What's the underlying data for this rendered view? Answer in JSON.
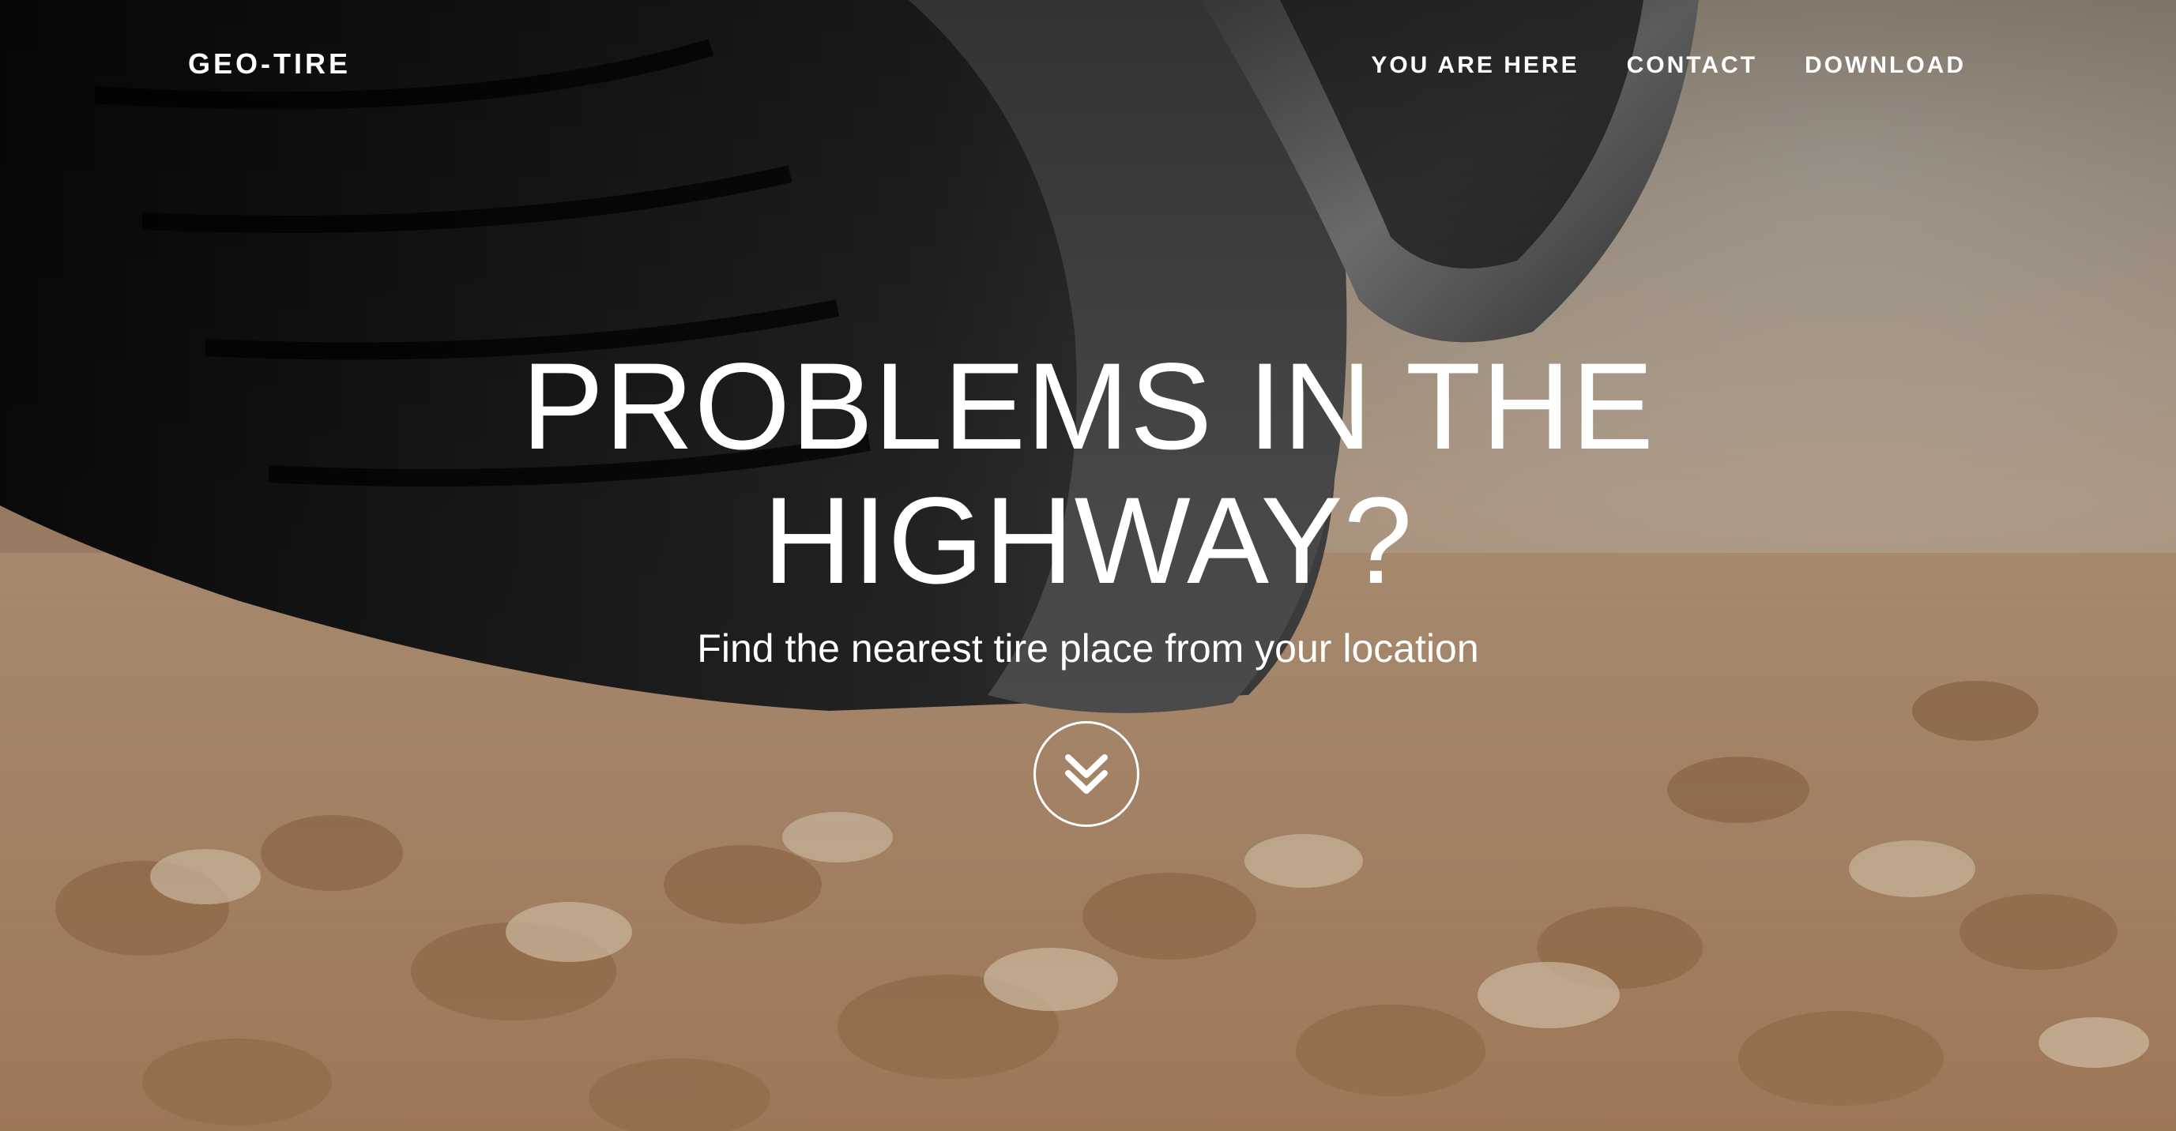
{
  "brand": {
    "name": "GEO-TIRE"
  },
  "nav": {
    "items": [
      {
        "label": "YOU ARE HERE"
      },
      {
        "label": "CONTACT"
      },
      {
        "label": "DOWNLOAD"
      }
    ]
  },
  "hero": {
    "headline_line1": "PROBLEMS IN THE",
    "headline_line2": "HIGHWAY?",
    "subtitle": "Find the nearest tire place from your location",
    "scroll_icon": "double-chevron-down-icon",
    "background": "photo of a car tire on gravel road"
  },
  "colors": {
    "text": "#ffffff",
    "gravel": "#c9a27a",
    "tire": "#1c1c1c"
  }
}
